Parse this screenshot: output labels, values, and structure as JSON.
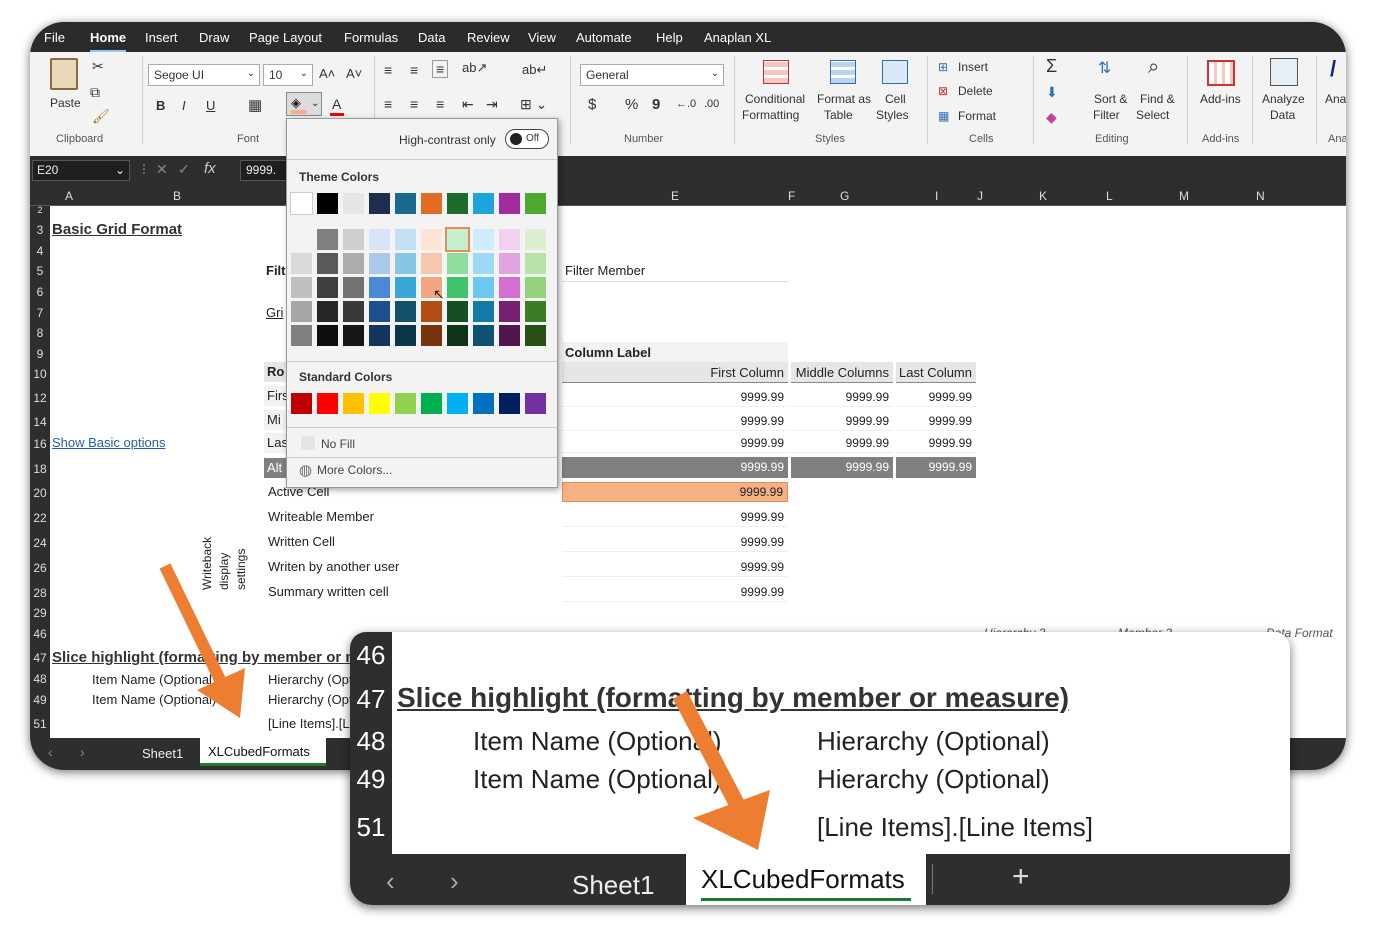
{
  "menu": {
    "items": [
      "File",
      "Home",
      "Insert",
      "Draw",
      "Page Layout",
      "Formulas",
      "Data",
      "Review",
      "View",
      "Automate",
      "Help",
      "Anaplan XL"
    ],
    "active": "Home"
  },
  "ribbon": {
    "clipboard": {
      "paste": "Paste",
      "label": "Clipboard"
    },
    "font": {
      "name": "Segoe UI",
      "size": "10",
      "label": "Font",
      "bold": "B",
      "italic": "I",
      "underline": "U",
      "grow": "A˄",
      "shrink": "A˅",
      "color_letter": "A"
    },
    "number": {
      "format": "General",
      "label": "Number",
      "currency": "$",
      "percent": "%",
      "comma": "9"
    },
    "styles": {
      "conditional": [
        "Conditional",
        "Formatting"
      ],
      "format_table": [
        "Format as",
        "Table"
      ],
      "cell_styles": [
        "Cell",
        "Styles"
      ],
      "label": "Styles"
    },
    "cells": {
      "insert": "Insert",
      "delete": "Delete",
      "format": "Format",
      "label": "Cells"
    },
    "editing": {
      "sort": [
        "Sort &",
        "Filter"
      ],
      "find": [
        "Find &",
        "Select"
      ],
      "label": "Editing"
    },
    "addins": {
      "addins": "Add-ins",
      "label": "Add-ins"
    },
    "analyze": [
      "Analyze",
      "Data"
    ],
    "cut_off": "Ana",
    "cut_off_label": "Ana"
  },
  "formula_bar": {
    "name_box": "E20",
    "value": "9999.",
    "fx": "fx"
  },
  "columns": [
    "A",
    "B",
    "E",
    "F",
    "G",
    "I",
    "J",
    "K",
    "L",
    "M",
    "N"
  ],
  "rows": [
    "2",
    "3",
    "4",
    "5",
    "6",
    "7",
    "8",
    "9",
    "10",
    "12",
    "14",
    "16",
    "18",
    "20",
    "22",
    "24",
    "26",
    "28",
    "29",
    "46",
    "47",
    "48",
    "49",
    "51"
  ],
  "sheet": {
    "title": "Basic Grid Format",
    "show_basic": "Show Basic options",
    "filter_label": "Filt",
    "grid_label": "Gri",
    "row_label": "Ro",
    "first_lbl": "Firs",
    "mid_lbl": "Mi",
    "last_lbl": "Las",
    "alt_lbl": "Alt",
    "filter_member": "Filter Member",
    "column_label": "Column Label",
    "col_headers": [
      "First Column",
      "Middle Columns",
      "Last Column"
    ],
    "value": "9999.99",
    "writeback_items": [
      "Active Cell",
      "Writeable Member",
      "Written Cell",
      "Writen by another user",
      "Summary written cell"
    ],
    "writeback_side": [
      "Writeback",
      "display",
      "settings"
    ],
    "hierarchy3": "Hierarchy 3",
    "member3": "Member 3",
    "data_format": "Data Format",
    "slice_title": "Slice highlight (formatting by member or measure)",
    "item_name": "Item Name (Optional)",
    "hierarchy": "Hierarchy (Optional)",
    "line_items": "[Line Items].[Line Items]"
  },
  "sheet_tabs": {
    "sheet1": "Sheet1",
    "active": "XLCubedFormats",
    "add": "+"
  },
  "palette": {
    "high_contrast": "High-contrast only",
    "toggle": "Off",
    "theme_title": "Theme Colors",
    "standard_title": "Standard Colors",
    "no_fill": "No Fill",
    "more_colors": "More Colors...",
    "theme_base": [
      "#ffffff",
      "#000000",
      "#e7e6e6",
      "#1f2d4d",
      "#1a6a8f",
      "#e46c22",
      "#1e6b30",
      "#1ea3dc",
      "#a02d9b",
      "#4ea72e"
    ],
    "theme_shades": [
      [
        "#f2f2f2",
        "#7f7f7f",
        "#d0cece",
        "#d6e4f5",
        "#c2e0f2",
        "#fbe3d6",
        "#c6efce",
        "#cdedfb",
        "#f1d0f0",
        "#dbf0d3"
      ],
      [
        "#d9d9d9",
        "#595959",
        "#aeabab",
        "#a9c8ec",
        "#87c6e6",
        "#f7c7ad",
        "#8fdd9f",
        "#9bd9f7",
        "#e2a3e1",
        "#b7e1a6"
      ],
      [
        "#bfbfbf",
        "#3f3f3f",
        "#767171",
        "#4a89d6",
        "#3aa7d9",
        "#f2a682",
        "#3fc46b",
        "#6cc8f2",
        "#d46fd2",
        "#93d27a"
      ],
      [
        "#a6a6a6",
        "#262626",
        "#3a3838",
        "#1b4f8e",
        "#12506b",
        "#b54e12",
        "#164f23",
        "#137aa8",
        "#782174",
        "#3a7d22"
      ],
      [
        "#808080",
        "#0d0d0d",
        "#171616",
        "#12355e",
        "#0c3547",
        "#78340c",
        "#0f3518",
        "#0d5270",
        "#50164d",
        "#274f17"
      ]
    ],
    "standard": [
      "#c00000",
      "#ff0000",
      "#ffc000",
      "#ffff00",
      "#92d050",
      "#00b050",
      "#00b0f0",
      "#0070c0",
      "#002060",
      "#7030a0"
    ]
  },
  "zoom": {
    "rows": [
      "46",
      "47",
      "48",
      "49",
      "51"
    ]
  }
}
